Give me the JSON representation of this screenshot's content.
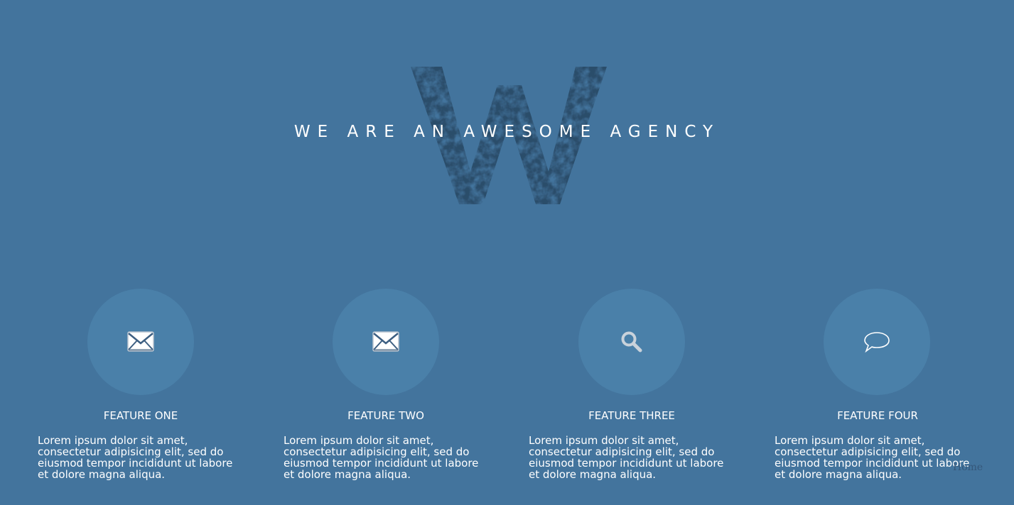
{
  "hero": {
    "title": "WE ARE AN AWESOME AGENCY",
    "logo_letter": "W"
  },
  "features": [
    {
      "title": "FEATURE ONE",
      "icon": "mail-icon",
      "description": "Lorem ipsum dolor sit amet, consectetur adipisicing elit, sed do eiusmod tempor incididunt ut labore et dolore magna aliqua."
    },
    {
      "title": "FEATURE TWO",
      "icon": "mail-icon",
      "description": "Lorem ipsum dolor sit amet, consectetur adipisicing elit, sed do eiusmod tempor incididunt ut labore et dolore magna aliqua."
    },
    {
      "title": "FEATURE THREE",
      "icon": "search-icon",
      "description": "Lorem ipsum dolor sit amet, consectetur adipisicing elit, sed do eiusmod tempor incididunt ut labore et dolore magna aliqua."
    },
    {
      "title": "FEATURE FOUR",
      "icon": "speech-bubble-icon",
      "description": "Lorem ipsum dolor sit amet, consectetur adipisicing elit, sed do eiusmod tempor incididunt ut labore et dolore magna aliqua."
    }
  ],
  "footer": {
    "home_label": "Home"
  },
  "colors": {
    "background": "#43749d",
    "circle": "#4a80a9",
    "logo": "#2b4d6b"
  }
}
